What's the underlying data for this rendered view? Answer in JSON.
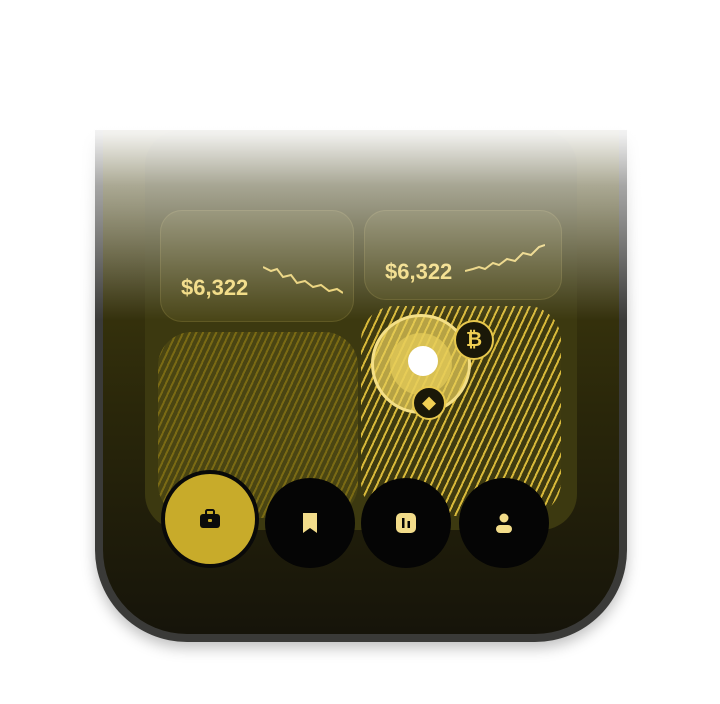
{
  "cards": {
    "left": {
      "amount": "$6,322"
    },
    "right": {
      "amount": "$6,322"
    }
  },
  "coins": {
    "btc": {
      "icon": "bitcoin-icon",
      "glyph": "₿"
    },
    "eth": {
      "icon": "ethereum-icon",
      "glyph": "◆"
    }
  },
  "nav": {
    "items": [
      {
        "icon": "briefcase-icon",
        "active": true
      },
      {
        "icon": "bookmark-icon",
        "active": false
      },
      {
        "icon": "chart-icon",
        "active": false
      },
      {
        "icon": "user-icon",
        "active": false
      }
    ]
  },
  "colors": {
    "accent": "#c8ab2a",
    "gold_text": "#f1d97a",
    "background": "#16140a"
  }
}
